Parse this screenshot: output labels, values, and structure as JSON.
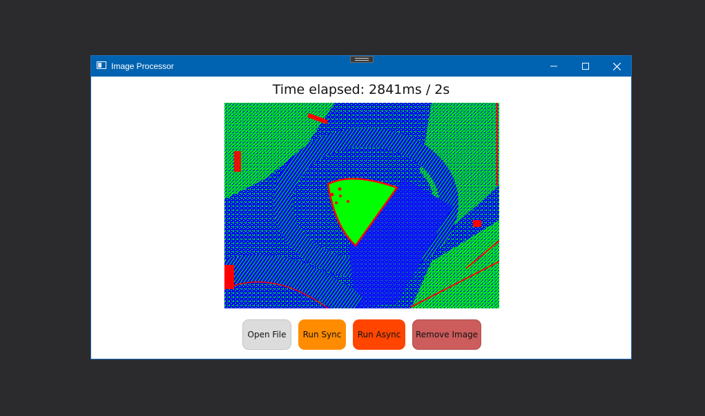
{
  "window": {
    "title": "Image Processor",
    "controls": {
      "minimize": "minimize-icon",
      "maximize": "maximize-icon",
      "close": "close-icon"
    }
  },
  "main": {
    "time_elapsed": "Time elapsed: 2841ms / 2s",
    "image": {
      "description_colors": {
        "blue": "#0000ff",
        "green": "#00ff00",
        "red": "#ff0000"
      }
    }
  },
  "buttons": {
    "open_file": "Open File",
    "run_sync": "Run Sync",
    "run_async": "Run Async",
    "remove_image": "Remove Image"
  },
  "colors": {
    "titlebar": "#0063b1",
    "run_sync": "#ff8c00",
    "run_async": "#ff4500",
    "remove_image": "#cd5c5c",
    "open_file": "#dcdcdc"
  }
}
